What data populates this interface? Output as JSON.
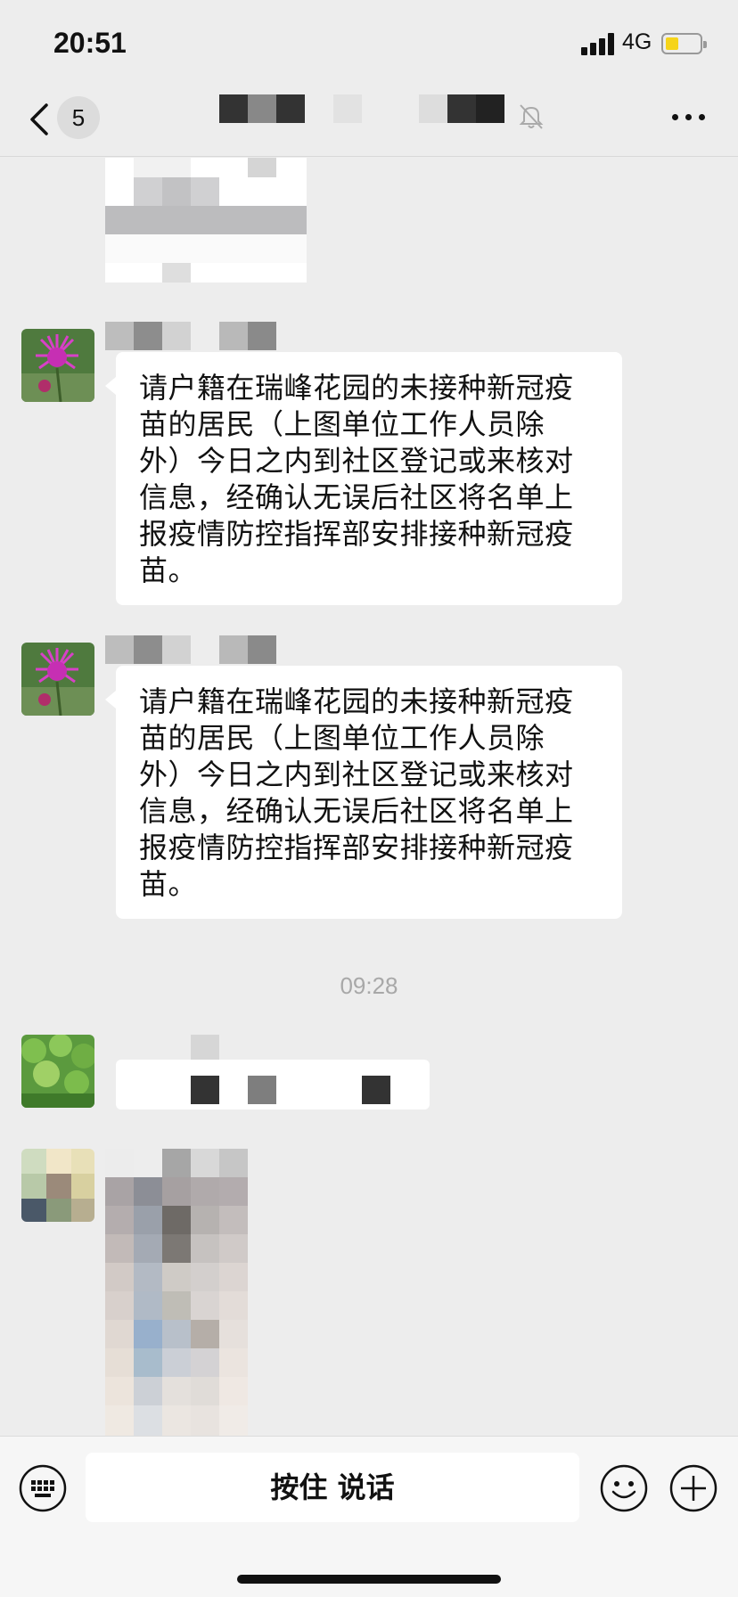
{
  "status_bar": {
    "time": "20:51",
    "network": "4G",
    "icons": [
      "signal-icon",
      "battery-icon"
    ]
  },
  "nav": {
    "unread_count": "5",
    "icons": [
      "back-arrow-icon",
      "mute-bell-icon",
      "more-dots-icon"
    ]
  },
  "messages": [
    {
      "text": "请户籍在瑞峰花园的未接种新冠疫苗的居民（上图单位工作人员除外）今日之内到社区登记或来核对信息，经确认无误后社区将名单上报疫情防控指挥部安排接种新冠疫苗。",
      "lines": [
        "请户籍在瑞峰花园的未接种新冠疫",
        "苗的居民（上图单位工作人员除",
        "外）今日之内到社区登记或来核对",
        "信息，经确认无误后社区将名单上",
        "报疫情防控指挥部安排接种新冠疫",
        "苗。"
      ]
    },
    {
      "text": "请户籍在瑞峰花园的未接种新冠疫苗的居民（上图单位工作人员除外）今日之内到社区登记或来核对信息，经确认无误后社区将名单上报疫情防控指挥部安排接种新冠疫苗。",
      "lines": [
        "请户籍在瑞峰花园的未接种新冠疫",
        "苗的居民（上图单位工作人员除",
        "外）今日之内到社区登记或来核对",
        "信息，经确认无误后社区将名单上",
        "报疫情防控指挥部安排接种新冠疫",
        "苗。"
      ]
    }
  ],
  "time_separator": "09:28",
  "toolbar": {
    "hold_to_talk": "按住 说话",
    "icons": [
      "keyboard-icon",
      "emoji-icon",
      "plus-icon"
    ]
  },
  "colors": {
    "background": "#ededed",
    "bubble": "#ffffff",
    "toolbar": "#f6f6f6",
    "battery": "#f6d41a"
  }
}
